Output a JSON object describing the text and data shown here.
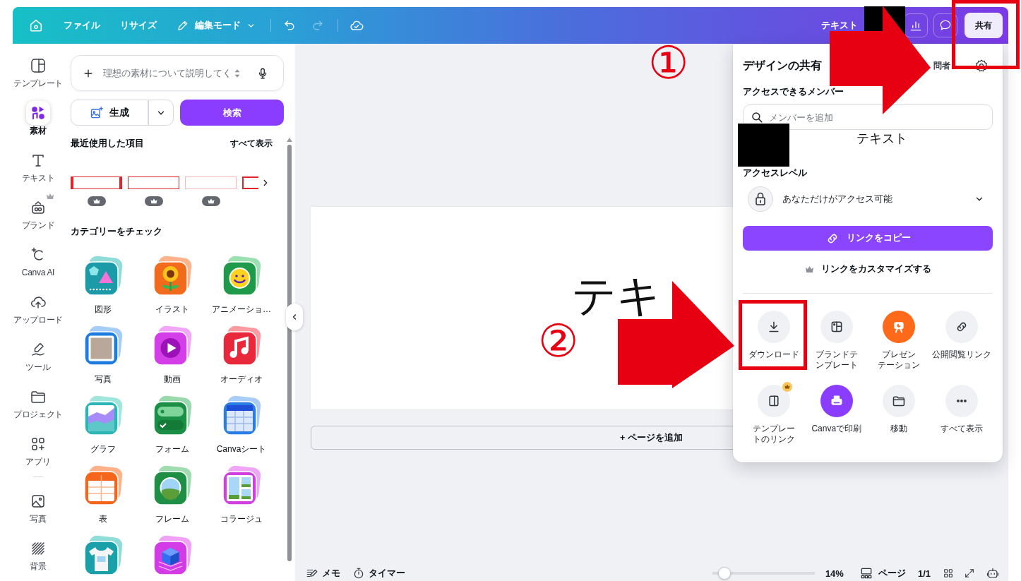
{
  "toolbar": {
    "menus": [
      {
        "label": "ファイル",
        "kind": "plain"
      },
      {
        "label": "リサイズ",
        "kind": "plain"
      },
      {
        "label": "編集モード",
        "kind": "mode"
      }
    ],
    "history": [
      {
        "disabled": false
      },
      {
        "disabled": true
      }
    ],
    "title": "テキスト",
    "share": "共有"
  },
  "rail": {
    "main": [
      {
        "label": "テンプレート",
        "selected": false,
        "premium": false
      },
      {
        "label": "素材",
        "selected": true,
        "premium": false
      },
      {
        "label": "テキスト",
        "selected": false,
        "premium": false
      },
      {
        "label": "ブランド",
        "selected": false,
        "premium": true
      },
      {
        "label": "Canva AI",
        "selected": false,
        "premium": false
      },
      {
        "label": "アップロード",
        "selected": false,
        "premium": false
      },
      {
        "label": "ツール",
        "selected": false,
        "premium": false
      },
      {
        "label": "プロジェクト",
        "selected": false,
        "premium": false
      },
      {
        "label": "アプリ",
        "selected": false,
        "premium": false
      }
    ],
    "more": [
      {
        "label": "写真",
        "selected": false,
        "premium": false
      },
      {
        "label": "背景",
        "selected": false,
        "premium": false
      }
    ]
  },
  "panel": {
    "search": {
      "placeholder": "理想の素材について説明してく"
    },
    "generate": "生成",
    "search_button": "検索",
    "recent": {
      "title": "最近使用した項目",
      "link": "すべて表示",
      "items": [
        {
          "premium": true
        },
        {
          "premium": true
        },
        {
          "premium": true
        },
        {
          "premium": false
        }
      ]
    },
    "categories": {
      "title": "カテゴリーをチェック",
      "items": [
        {
          "label": "図形",
          "kind": "shapes"
        },
        {
          "label": "イラスト",
          "kind": "illustration"
        },
        {
          "label": "アニメーショ…",
          "kind": "animation"
        },
        {
          "label": "写真",
          "kind": "photo"
        },
        {
          "label": "動画",
          "kind": "video"
        },
        {
          "label": "オーディオ",
          "kind": "audio"
        },
        {
          "label": "グラフ",
          "kind": "chart"
        },
        {
          "label": "フォーム",
          "kind": "form"
        },
        {
          "label": "Canvaシート",
          "kind": "sheet"
        },
        {
          "label": "表",
          "kind": "table"
        },
        {
          "label": "フレーム",
          "kind": "frame"
        },
        {
          "label": "コラージュ",
          "kind": "collage"
        },
        {
          "kind": "tshirt"
        },
        {
          "kind": "cube"
        }
      ]
    }
  },
  "canvas": {
    "page_text": "テキ",
    "add_page": "+ ページを追加"
  },
  "footer": {
    "notes": "メモ",
    "timer": "タイマー",
    "zoom": {
      "level": 0.06,
      "reading": "14%"
    },
    "pages": "ページ",
    "page_count": "1/1"
  },
  "share_panel": {
    "title": "デザインの共有",
    "visitor": "問者",
    "members_label": "アクセスできるメンバー",
    "member_search": {
      "placeholder": "メンバーを追加"
    },
    "access_label": "アクセスレベル",
    "access": "あなただけがアクセス可能",
    "copy_link": "リンクをコピー",
    "customize": "リンクをカスタマイズする",
    "actions": [
      {
        "label": "ダウンロード",
        "premium": false
      },
      {
        "label": "ブランドテンプレート",
        "premium": false
      },
      {
        "label": "プレゼンテーション",
        "premium": false
      },
      {
        "label": "公開閲覧リンク",
        "premium": false
      },
      {
        "label": "テンプレートのリンク",
        "premium": true
      },
      {
        "label": "Canvaで印刷",
        "premium": false
      },
      {
        "label": "移動",
        "premium": false
      },
      {
        "label": "すべて表示",
        "premium": false
      }
    ]
  },
  "annotations": {
    "steps": [
      "①",
      "②"
    ],
    "note": "テキスト"
  }
}
